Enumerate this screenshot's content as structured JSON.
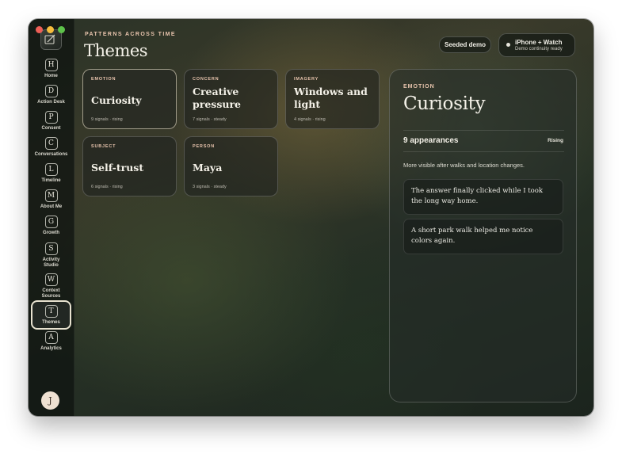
{
  "sidebar": {
    "items": [
      {
        "letter": "H",
        "label": "Home"
      },
      {
        "letter": "D",
        "label": "Action Desk"
      },
      {
        "letter": "P",
        "label": "Consent"
      },
      {
        "letter": "C",
        "label": "Conversations"
      },
      {
        "letter": "L",
        "label": "Timeline"
      },
      {
        "letter": "M",
        "label": "About Me"
      },
      {
        "letter": "G",
        "label": "Growth"
      },
      {
        "letter": "S",
        "label": "Activity Studio"
      },
      {
        "letter": "W",
        "label": "Context Sources"
      },
      {
        "letter": "T",
        "label": "Themes",
        "active": true
      },
      {
        "letter": "A",
        "label": "Analytics"
      }
    ],
    "avatar": "J"
  },
  "header": {
    "eyebrow": "PATTERNS ACROSS TIME",
    "title": "Themes",
    "demo_pill": "Seeded demo",
    "device_title": "iPhone + Watch",
    "device_status": "Demo continuity ready"
  },
  "themes": [
    {
      "kind": "EMOTION",
      "name": "Curiosity",
      "meta": "9 signals · rising",
      "selected": true
    },
    {
      "kind": "CONCERN",
      "name": "Creative pressure",
      "meta": "7 signals · steady"
    },
    {
      "kind": "IMAGERY",
      "name": "Windows and light",
      "meta": "4 signals · rising"
    },
    {
      "kind": "SUBJECT",
      "name": "Self-trust",
      "meta": "6 signals · rising"
    },
    {
      "kind": "PERSON",
      "name": "Maya",
      "meta": "3 signals · steady"
    }
  ],
  "detail": {
    "kind": "EMOTION",
    "title": "Curiosity",
    "appearances": "9 appearances",
    "trend": "Rising",
    "description": "More visible after walks and location changes.",
    "quotes": [
      "The answer finally clicked while I took the long way home.",
      "A short park walk helped me notice colors again."
    ]
  },
  "colors": {
    "accent": "#e9c5ae",
    "traffic_red": "#ee5f57",
    "traffic_yellow": "#f6bd3d",
    "traffic_green": "#5dc24a"
  }
}
